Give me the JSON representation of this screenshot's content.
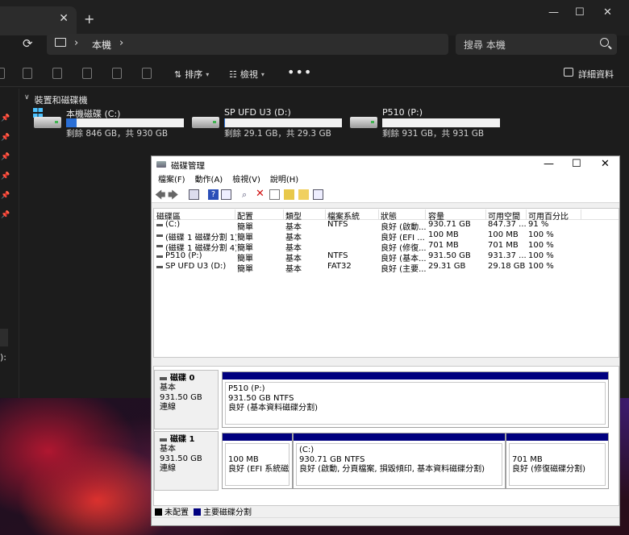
{
  "explorer": {
    "address": {
      "crumb": "本機"
    },
    "search": {
      "placeholder": "搜尋 本機"
    },
    "toolbar": {
      "sort_label": "排序",
      "view_label": "檢視",
      "more_label": "•••",
      "details_label": "詳細資料"
    },
    "nav": {
      "partial_label": "):"
    },
    "section": {
      "title": "裝置和磁碟機"
    },
    "drives": [
      {
        "name": "本機磁碟 (C:)",
        "size_text": "剩餘 846 GB，共 930 GB",
        "used_fraction": 0.09
      },
      {
        "name": "SP UFD U3 (D:)",
        "size_text": "剩餘 29.1 GB，共 29.3 GB",
        "used_fraction": 0.007
      },
      {
        "name": "P510 (P:)",
        "size_text": "剩餘 931 GB，共 931 GB",
        "used_fraction": 0.0
      }
    ]
  },
  "diskmgmt": {
    "title": "磁碟管理",
    "menu": [
      "檔案(F)",
      "動作(A)",
      "檢視(V)",
      "說明(H)"
    ],
    "columns": [
      "磁碟區",
      "配置",
      "類型",
      "檔案系統",
      "狀態",
      "容量",
      "可用空間",
      "可用百分比"
    ],
    "rows": [
      [
        "(C:)",
        "簡單",
        "基本",
        "NTFS",
        "良好 (啟動...",
        "930.71 GB",
        "847.37 ...",
        "91 %"
      ],
      [
        "(磁碟 1 磁碟分割 1)",
        "簡單",
        "基本",
        "",
        "良好 (EFI ...",
        "100 MB",
        "100 MB",
        "100 %"
      ],
      [
        "(磁碟 1 磁碟分割 4)",
        "簡單",
        "基本",
        "",
        "良好 (修復...",
        "701 MB",
        "701 MB",
        "100 %"
      ],
      [
        "P510 (P:)",
        "簡單",
        "基本",
        "NTFS",
        "良好 (基本...",
        "931.50 GB",
        "931.37 ...",
        "100 %"
      ],
      [
        "SP UFD U3 (D:)",
        "簡單",
        "基本",
        "FAT32",
        "良好 (主要...",
        "29.31 GB",
        "29.18 GB",
        "100 %"
      ]
    ],
    "disks": [
      {
        "name": "磁碟 0",
        "type": "基本",
        "size": "931.50 GB",
        "status": "連線",
        "partitions": [
          {
            "line1": "P510  (P:)",
            "line2": "931.50 GB NTFS",
            "line3": "良好 (基本資料磁碟分割)"
          }
        ]
      },
      {
        "name": "磁碟 1",
        "type": "基本",
        "size": "931.50 GB",
        "status": "連線",
        "partitions": [
          {
            "line1": "",
            "line2": "100 MB",
            "line3": "良好 (EFI 系統磁碟"
          },
          {
            "line1": "(C:)",
            "line2": "930.71 GB NTFS",
            "line3": "良好 (啟動, 分頁檔案, 損毀傾印, 基本資料磁碟分割)"
          },
          {
            "line1": "",
            "line2": "701 MB",
            "line3": "良好 (修復磁碟分割)"
          }
        ]
      }
    ],
    "legend": {
      "unallocated": "未配置",
      "primary": "主要磁碟分割"
    },
    "colors": {
      "primary": "#00007f",
      "unallocated": "#000000"
    }
  }
}
